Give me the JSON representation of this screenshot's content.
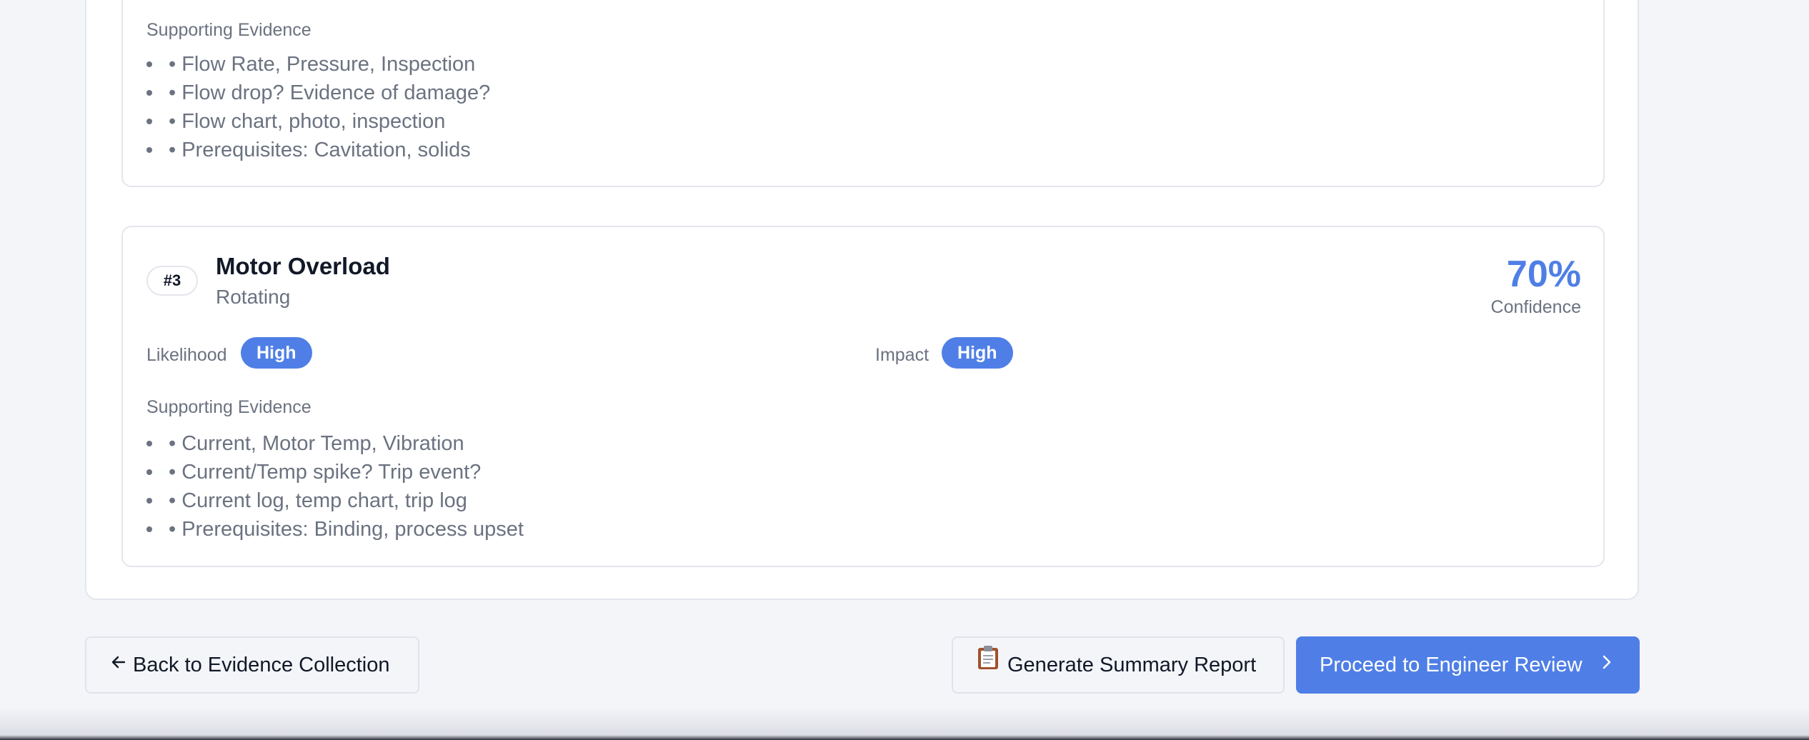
{
  "cards": [
    {
      "supporting_evidence_label": "Supporting Evidence",
      "evidence": [
        "• Flow Rate, Pressure, Inspection",
        "• Flow drop? Evidence of damage?",
        "• Flow chart, photo, inspection",
        "• Prerequisites: Cavitation, solids"
      ]
    },
    {
      "rank": "#3",
      "title": "Motor Overload",
      "category": "Rotating",
      "confidence_value": "70%",
      "confidence_label": "Confidence",
      "likelihood_label": "Likelihood",
      "likelihood_value": "High",
      "impact_label": "Impact",
      "impact_value": "High",
      "supporting_evidence_label": "Supporting Evidence",
      "evidence": [
        "• Current, Motor Temp, Vibration",
        "• Current/Temp spike? Trip event?",
        "• Current log, temp chart, trip log",
        "• Prerequisites: Binding, process upset"
      ]
    }
  ],
  "actions": {
    "back_label": "Back to Evidence Collection",
    "report_label": "Generate Summary Report",
    "proceed_label": "Proceed to Engineer Review"
  },
  "icons": {
    "back": "arrow-left-icon",
    "report": "clipboard-icon",
    "proceed": "chevron-right-icon"
  },
  "colors": {
    "accent": "#4f7fe6",
    "muted_text": "#6b7280",
    "border": "#e3e6ec",
    "background": "#f4f5f9"
  }
}
